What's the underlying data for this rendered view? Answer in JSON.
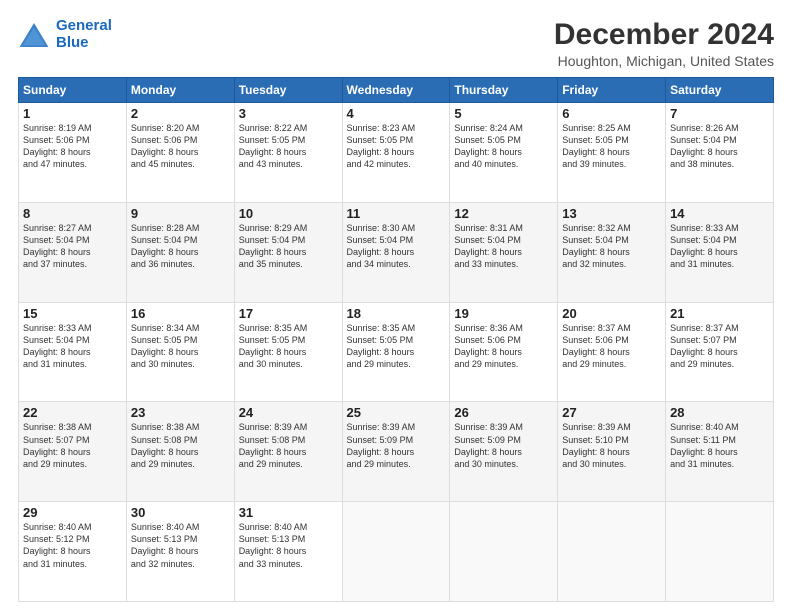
{
  "logo": {
    "line1": "General",
    "line2": "Blue"
  },
  "title": "December 2024",
  "subtitle": "Houghton, Michigan, United States",
  "days_header": [
    "Sunday",
    "Monday",
    "Tuesday",
    "Wednesday",
    "Thursday",
    "Friday",
    "Saturday"
  ],
  "weeks": [
    [
      {
        "day": "1",
        "info": "Sunrise: 8:19 AM\nSunset: 5:06 PM\nDaylight: 8 hours\nand 47 minutes."
      },
      {
        "day": "2",
        "info": "Sunrise: 8:20 AM\nSunset: 5:06 PM\nDaylight: 8 hours\nand 45 minutes."
      },
      {
        "day": "3",
        "info": "Sunrise: 8:22 AM\nSunset: 5:05 PM\nDaylight: 8 hours\nand 43 minutes."
      },
      {
        "day": "4",
        "info": "Sunrise: 8:23 AM\nSunset: 5:05 PM\nDaylight: 8 hours\nand 42 minutes."
      },
      {
        "day": "5",
        "info": "Sunrise: 8:24 AM\nSunset: 5:05 PM\nDaylight: 8 hours\nand 40 minutes."
      },
      {
        "day": "6",
        "info": "Sunrise: 8:25 AM\nSunset: 5:05 PM\nDaylight: 8 hours\nand 39 minutes."
      },
      {
        "day": "7",
        "info": "Sunrise: 8:26 AM\nSunset: 5:04 PM\nDaylight: 8 hours\nand 38 minutes."
      }
    ],
    [
      {
        "day": "8",
        "info": "Sunrise: 8:27 AM\nSunset: 5:04 PM\nDaylight: 8 hours\nand 37 minutes."
      },
      {
        "day": "9",
        "info": "Sunrise: 8:28 AM\nSunset: 5:04 PM\nDaylight: 8 hours\nand 36 minutes."
      },
      {
        "day": "10",
        "info": "Sunrise: 8:29 AM\nSunset: 5:04 PM\nDaylight: 8 hours\nand 35 minutes."
      },
      {
        "day": "11",
        "info": "Sunrise: 8:30 AM\nSunset: 5:04 PM\nDaylight: 8 hours\nand 34 minutes."
      },
      {
        "day": "12",
        "info": "Sunrise: 8:31 AM\nSunset: 5:04 PM\nDaylight: 8 hours\nand 33 minutes."
      },
      {
        "day": "13",
        "info": "Sunrise: 8:32 AM\nSunset: 5:04 PM\nDaylight: 8 hours\nand 32 minutes."
      },
      {
        "day": "14",
        "info": "Sunrise: 8:33 AM\nSunset: 5:04 PM\nDaylight: 8 hours\nand 31 minutes."
      }
    ],
    [
      {
        "day": "15",
        "info": "Sunrise: 8:33 AM\nSunset: 5:04 PM\nDaylight: 8 hours\nand 31 minutes."
      },
      {
        "day": "16",
        "info": "Sunrise: 8:34 AM\nSunset: 5:05 PM\nDaylight: 8 hours\nand 30 minutes."
      },
      {
        "day": "17",
        "info": "Sunrise: 8:35 AM\nSunset: 5:05 PM\nDaylight: 8 hours\nand 30 minutes."
      },
      {
        "day": "18",
        "info": "Sunrise: 8:35 AM\nSunset: 5:05 PM\nDaylight: 8 hours\nand 29 minutes."
      },
      {
        "day": "19",
        "info": "Sunrise: 8:36 AM\nSunset: 5:06 PM\nDaylight: 8 hours\nand 29 minutes."
      },
      {
        "day": "20",
        "info": "Sunrise: 8:37 AM\nSunset: 5:06 PM\nDaylight: 8 hours\nand 29 minutes."
      },
      {
        "day": "21",
        "info": "Sunrise: 8:37 AM\nSunset: 5:07 PM\nDaylight: 8 hours\nand 29 minutes."
      }
    ],
    [
      {
        "day": "22",
        "info": "Sunrise: 8:38 AM\nSunset: 5:07 PM\nDaylight: 8 hours\nand 29 minutes."
      },
      {
        "day": "23",
        "info": "Sunrise: 8:38 AM\nSunset: 5:08 PM\nDaylight: 8 hours\nand 29 minutes."
      },
      {
        "day": "24",
        "info": "Sunrise: 8:39 AM\nSunset: 5:08 PM\nDaylight: 8 hours\nand 29 minutes."
      },
      {
        "day": "25",
        "info": "Sunrise: 8:39 AM\nSunset: 5:09 PM\nDaylight: 8 hours\nand 29 minutes."
      },
      {
        "day": "26",
        "info": "Sunrise: 8:39 AM\nSunset: 5:09 PM\nDaylight: 8 hours\nand 30 minutes."
      },
      {
        "day": "27",
        "info": "Sunrise: 8:39 AM\nSunset: 5:10 PM\nDaylight: 8 hours\nand 30 minutes."
      },
      {
        "day": "28",
        "info": "Sunrise: 8:40 AM\nSunset: 5:11 PM\nDaylight: 8 hours\nand 31 minutes."
      }
    ],
    [
      {
        "day": "29",
        "info": "Sunrise: 8:40 AM\nSunset: 5:12 PM\nDaylight: 8 hours\nand 31 minutes."
      },
      {
        "day": "30",
        "info": "Sunrise: 8:40 AM\nSunset: 5:13 PM\nDaylight: 8 hours\nand 32 minutes."
      },
      {
        "day": "31",
        "info": "Sunrise: 8:40 AM\nSunset: 5:13 PM\nDaylight: 8 hours\nand 33 minutes."
      },
      null,
      null,
      null,
      null
    ]
  ]
}
